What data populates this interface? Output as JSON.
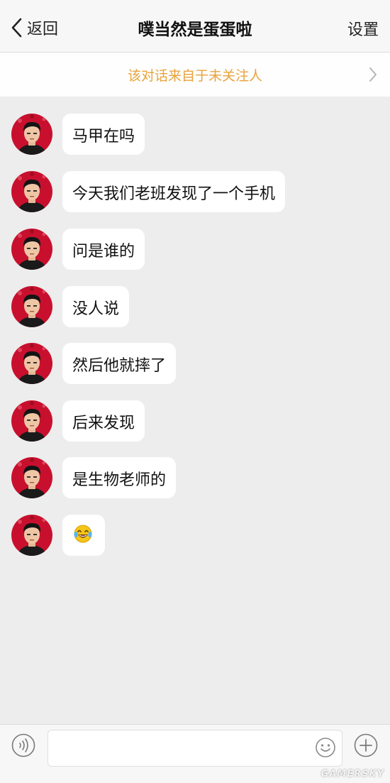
{
  "navbar": {
    "back_label": "返回",
    "title": "噗当然是蛋蛋啦",
    "settings_label": "设置"
  },
  "notice": {
    "text": "该对话来自于未关注人"
  },
  "messages": [
    {
      "text": "马甲在吗"
    },
    {
      "text": "今天我们老班发现了一个手机"
    },
    {
      "text": "问是谁的"
    },
    {
      "text": "没人说"
    },
    {
      "text": "然后他就摔了"
    },
    {
      "text": "后来发现"
    },
    {
      "text": "是生物老师的"
    },
    {
      "emoji": "laughing-crying-emoji"
    }
  ],
  "inputbar": {
    "value": "",
    "placeholder": ""
  },
  "watermark": "GAMERSKY",
  "colors": {
    "background": "#ededed",
    "notice_text": "#e8a33b",
    "bubble": "#ffffff",
    "avatar_bg": "#c8102e"
  },
  "icons": [
    "chevron-left-icon",
    "chevron-right-icon",
    "voice-icon",
    "emoji-icon",
    "plus-icon",
    "avatar"
  ]
}
